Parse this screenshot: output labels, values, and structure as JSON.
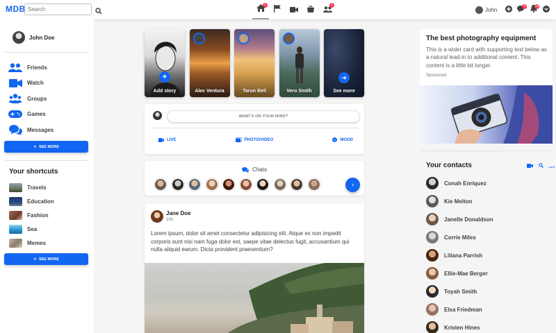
{
  "navbar": {
    "logo": "MDB",
    "search_placeholder": "Search",
    "user_name": "John",
    "badges": {
      "home": "1",
      "groups": "2",
      "messages": "6",
      "notifications": "12"
    }
  },
  "sidebar": {
    "profile_name": "John Doe",
    "items": [
      {
        "label": "Friends",
        "icon": "friends-icon"
      },
      {
        "label": "Watch",
        "icon": "video-icon"
      },
      {
        "label": "Groups",
        "icon": "groups-icon"
      },
      {
        "label": "Games",
        "icon": "gamepad-icon"
      },
      {
        "label": "Messages",
        "icon": "messages-icon"
      }
    ],
    "see_more": "SEE MORE",
    "shortcuts_title": "Your shortcuts",
    "shortcuts": [
      {
        "label": "Travels"
      },
      {
        "label": "Education"
      },
      {
        "label": "Fashion"
      },
      {
        "label": "Sea"
      },
      {
        "label": "Memes"
      }
    ],
    "see_more_2": "SEE MORE"
  },
  "stories": [
    {
      "label": "Add story"
    },
    {
      "label": "Alec Ventura"
    },
    {
      "label": "Tarun Beil"
    },
    {
      "label": "Vero Smith"
    },
    {
      "label": "See more"
    }
  ],
  "post_box": {
    "prompt": "WHAT'S ON YOUR MIND?",
    "actions": [
      {
        "label": "LIVE",
        "icon": "video-icon"
      },
      {
        "label": "PHOTO/VIDEO",
        "icon": "photo-icon"
      },
      {
        "label": "MOOD",
        "icon": "smile-icon"
      }
    ]
  },
  "chats": {
    "title": "Chats"
  },
  "post": {
    "author": "Jane Doe",
    "time": "10h",
    "text": "Lorem ipsum, dolor sit amet consectetur adipisicing elit. Atque ex non impedit corporis sunt nisi nam fuga dolor est, saepe vitae delectus fugit, accusantium qui nulla aliquid earum. Dicta provident praesentium?"
  },
  "promo": {
    "title": "The best photography equipment",
    "text": "This is a wider card with supporting text below as a natural lead-in to additional content. This content is a little bit longer.",
    "sponsored": "Sponsored"
  },
  "contacts": {
    "title": "Your contacts",
    "list": [
      {
        "name": "Conah Enriquez"
      },
      {
        "name": "Kie Melton"
      },
      {
        "name": "Janelle Donaldson"
      },
      {
        "name": "Corrie Miles"
      },
      {
        "name": "Liliana Parrish"
      },
      {
        "name": "Ellie-Mae Berger"
      },
      {
        "name": "Toyah Smith"
      },
      {
        "name": "Elsa Friedman"
      },
      {
        "name": "Kristen Hines"
      }
    ]
  },
  "colors": {
    "primary": "#1266f1",
    "badge": "#f93154"
  }
}
